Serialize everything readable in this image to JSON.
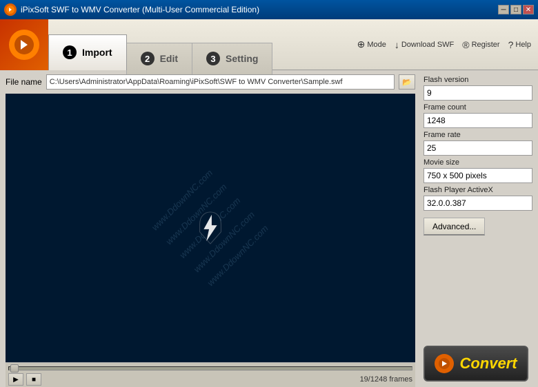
{
  "titlebar": {
    "title": "iPixSoft SWF to WMV Converter (Multi-User Commercial Edition)",
    "min_label": "─",
    "max_label": "□",
    "close_label": "✕"
  },
  "toolbar": {
    "mode_label": "Mode",
    "download_label": "Download SWF",
    "register_label": "Register",
    "help_label": "Help"
  },
  "tabs": [
    {
      "num": "1",
      "label": "Import"
    },
    {
      "num": "2",
      "label": "Edit"
    },
    {
      "num": "3",
      "label": "Setting"
    }
  ],
  "file": {
    "label": "File name",
    "value": "C:\\Users\\Administrator\\AppData\\Roaming\\iPixSoft\\SWF to WMV Converter\\Sample.swf",
    "browse_label": "▶"
  },
  "info": {
    "flash_version_label": "Flash version",
    "flash_version_value": "9",
    "frame_count_label": "Frame count",
    "frame_count_value": "1248",
    "frame_rate_label": "Frame rate",
    "frame_rate_value": "25",
    "movie_size_label": "Movie size",
    "movie_size_value": "750 x 500 pixels",
    "flash_player_label": "Flash Player ActiveX",
    "flash_player_value": "32.0.0.387"
  },
  "advanced_btn": "Advanced...",
  "playback": {
    "frame_info": "19/1248 frames",
    "play_label": "▶",
    "stop_label": "■"
  },
  "convert": {
    "label": "Convert"
  },
  "watermark_lines": [
    "www.DdownNC.com",
    "www.DdownNC.com",
    "www.DdownNC.com",
    "www.DdownNC.com"
  ]
}
